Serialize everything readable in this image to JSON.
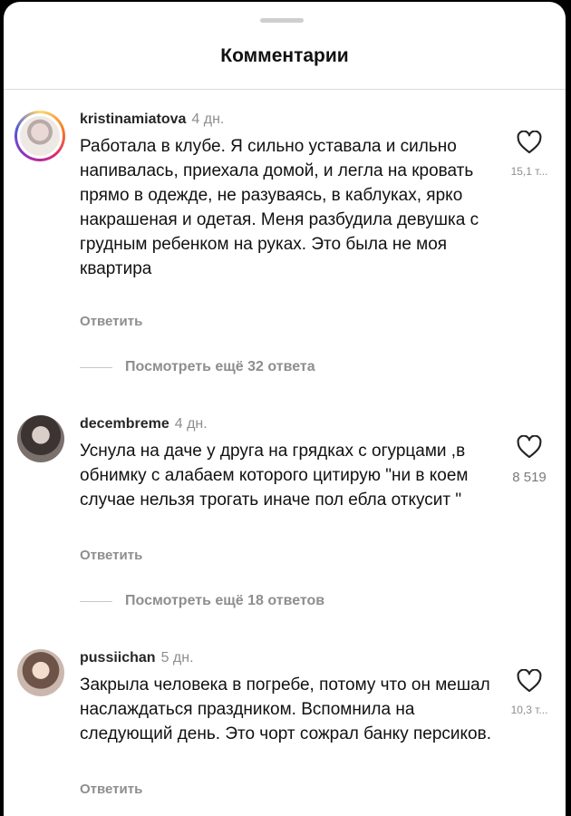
{
  "header": {
    "title": "Комментарии"
  },
  "comments": [
    {
      "username": "kristinamiatova",
      "age": "4 дн.",
      "text": "Работала в клубе. Я сильно уставала и сильно напивалась, приехала домой, и легла на кровать прямо в одежде, не разуваясь, в каблуках, ярко накрашеная и одетая. Меня разбудила девушка с грудным ребенком на руках. Это была не моя квартира",
      "reply_label": "Ответить",
      "like_count": "15,1 т...",
      "view_replies": "Посмотреть ещё 32 ответа",
      "has_story_ring": true
    },
    {
      "username": "decembreme",
      "age": "4 дн.",
      "text": "Уснула на даче у друга на грядках с огурцами ,в обнимку с алабаем которого цитирую \"ни в коем случае нельзя трогать иначе пол ебла откусит \"",
      "reply_label": "Ответить",
      "like_count": "8 519",
      "view_replies": "Посмотреть ещё 18 ответов",
      "has_story_ring": false
    },
    {
      "username": "pussiichan",
      "age": "5 дн.",
      "text": "Закрыла человека в погребе, потому что он мешал наслаждаться праздником. Вспомнила на следующий день. Это чорт сожрал банку персиков.",
      "reply_label": "Ответить",
      "like_count": "10,3 т...",
      "has_story_ring": false
    }
  ],
  "icons": {
    "like": "heart-outline-icon",
    "drag": "drag-handle"
  },
  "colors": {
    "text": "#111111",
    "muted": "#8e8e8e",
    "divider": "#dbdbdb",
    "background": "#ffffff"
  }
}
